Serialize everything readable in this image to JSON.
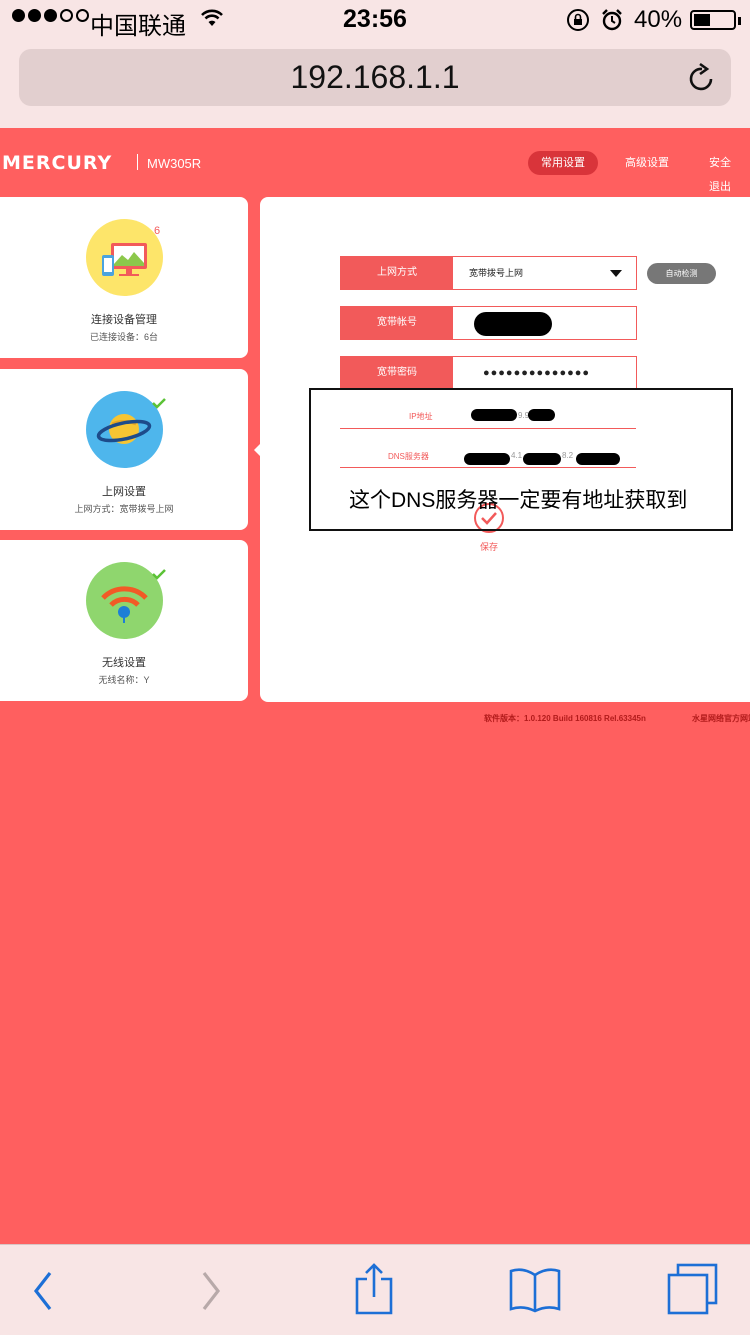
{
  "status_bar": {
    "carrier": "中国联通",
    "time": "23:56",
    "battery_percent": "40%",
    "signal_bars_filled": 3,
    "signal_bars_total": 5,
    "battery_level": 0.4
  },
  "browser": {
    "url": "192.168.1.1"
  },
  "router": {
    "logo": "MERCURY",
    "model": "MW305R",
    "nav": [
      "常用设置",
      "高级设置",
      "安全退出"
    ],
    "active_nav": "常用设置"
  },
  "sidebar": {
    "cards": [
      {
        "title": "连接设备管理",
        "subtitle": "已连接设备：6台",
        "badge": "6"
      },
      {
        "title": "上网设置",
        "subtitle": "上网方式：宽带拨号上网"
      },
      {
        "title": "无线设置",
        "subtitle": "无线名称：Y"
      }
    ]
  },
  "form": {
    "connection_type_label": "上网方式",
    "connection_type_value": "宽带拨号上网",
    "auto_detect_button": "自动检测",
    "account_label": "宽带帐号",
    "password_label": "宽带密码",
    "password_value": "●●●●●●●●●●●●●●",
    "ip_label": "IP地址",
    "ip_visible_fragment": "9.9",
    "dns_label": "DNS服务器",
    "dns_visible_fragment_1": "4.1",
    "dns_visible_fragment_2": "8.2",
    "save_label": "保存"
  },
  "annotation": {
    "text": "这个DNS服务器一定要有地址获取到"
  },
  "footer": {
    "version": "软件版本：1.0.120 Build 160816 Rel.63345n",
    "link": "水星网络官方网站"
  },
  "colors": {
    "page_bg": "#ff5f5f",
    "accent": "#f25a5a",
    "nav_active": "#d9343a",
    "ios_tint": "#1d6fd6"
  }
}
